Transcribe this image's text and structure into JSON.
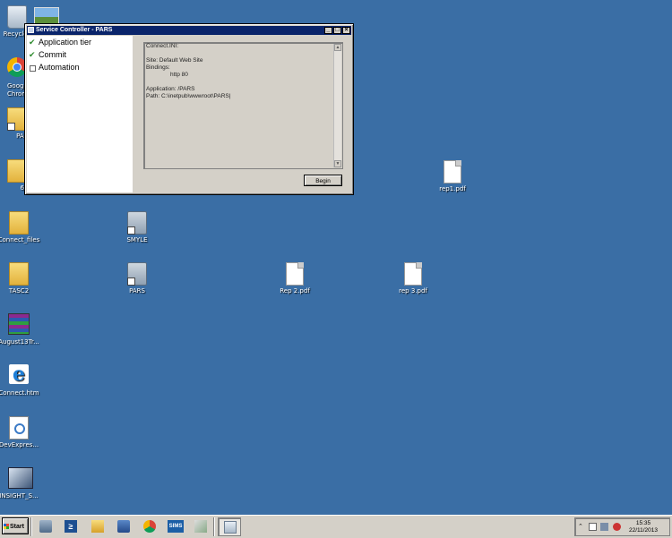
{
  "desktop": {
    "icons": {
      "recycle": "Recycle Bin",
      "chrome": "Google Chrome",
      "pars_shortcut": "PARS",
      "folder62": "62",
      "connect_files": "Connect_files",
      "tasc2": "TASC2",
      "august": "August13Tr...",
      "connect_htm": "Connect.htm",
      "devexpress": "DevExpres...",
      "insight": "INSIGHT_S...",
      "smyle": "SMYLE",
      "pars": "PARS",
      "rep1": "rep1.pdf",
      "rep2": "Rep 2.pdf",
      "rep3": "rep 3.pdf"
    }
  },
  "window": {
    "title": "Service Controller - PARS",
    "buttons": {
      "minimize": "_",
      "maximize": "□",
      "close": "×"
    },
    "tree": [
      {
        "label": "Application tier",
        "checked": true
      },
      {
        "label": "Commit",
        "checked": true
      },
      {
        "label": "Automation",
        "checked": false
      }
    ],
    "log": {
      "line1": "Connect.INI:",
      "line2": "",
      "line3": "Site: Default Web Site",
      "line4": "Bindings:",
      "line5": "http 80",
      "line6": "",
      "line7": "Application: /PARS",
      "line8": "Path: C:\\inetpub\\wwwroot\\PARS|"
    },
    "begin_label": "Begin"
  },
  "taskbar": {
    "start_label": "Start",
    "sims_label": "SIMS",
    "powershell_glyph": "≥",
    "clock_time": "15:35",
    "clock_date": "22/11/2013",
    "tray_chevron": "⌃"
  }
}
